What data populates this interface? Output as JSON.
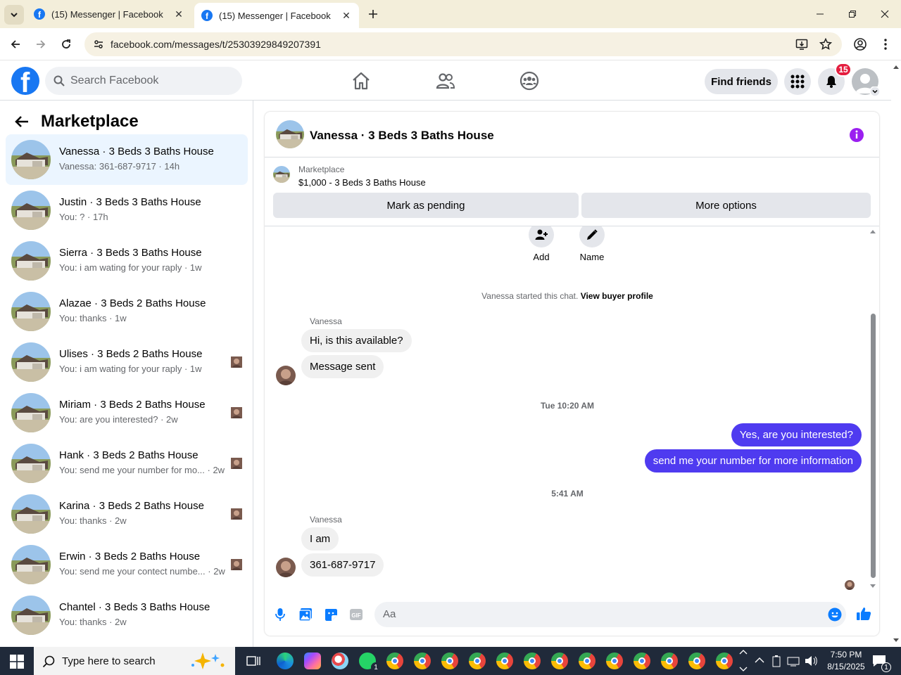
{
  "browser": {
    "tabs": [
      {
        "title": "(15) Messenger | Facebook"
      },
      {
        "title": "(15) Messenger | Facebook"
      }
    ],
    "url": "facebook.com/messages/t/25303929849207391"
  },
  "fb_header": {
    "search_placeholder": "Search Facebook",
    "find_friends": "Find friends",
    "notification_count": "15"
  },
  "left_panel": {
    "title": "Marketplace",
    "conversations": [
      {
        "name": "Vanessa · 3 Beds 3 Baths House",
        "preview": "Vanessa: 361-687-9717 · 14h"
      },
      {
        "name": "Justin · 3 Beds 3 Baths House",
        "preview": "You: ? · 17h"
      },
      {
        "name": "Sierra · 3 Beds 3 Baths House",
        "preview": "You: i am wating for your raply · 1w"
      },
      {
        "name": "Alazae · 3 Beds 2 Baths House",
        "preview": "You: thanks · 1w"
      },
      {
        "name": "Ulises · 3 Beds 2 Baths House",
        "preview": "You: i am wating for your raply · 1w"
      },
      {
        "name": "Miriam · 3 Beds 2 Baths House",
        "preview": "You: are you interested? · 2w"
      },
      {
        "name": "Hank · 3 Beds 2 Baths House",
        "preview": "You: send me your number for mo... · 2w"
      },
      {
        "name": "Karina · 3 Beds 2 Baths House",
        "preview": "You: thanks · 2w"
      },
      {
        "name": "Erwin · 3 Beds 2 Baths House",
        "preview": "You: send me your contect numbe... · 2w"
      },
      {
        "name": "Chantel · 3 Beds 3 Baths House",
        "preview": "You: thanks · 2w"
      }
    ]
  },
  "chat": {
    "title": "Vanessa · 3 Beds 3 Baths House",
    "listing_label": "Marketplace",
    "listing_title": "$1,000 - 3 Beds 3 Baths House",
    "mark_pending": "Mark as pending",
    "more_options": "More options",
    "actions": {
      "add": "Add",
      "name": "Name"
    },
    "started_text": "Vanessa started this chat.",
    "view_profile": "View buyer profile",
    "messages": {
      "sender1": "Vanessa",
      "in1": "Hi, is this available?",
      "in2": "Message sent",
      "stamp1": "Tue 10:20 AM",
      "out1": "Yes, are you interested?",
      "out2": "send me your number for more information",
      "stamp2": "5:41 AM",
      "sender2": "Vanessa",
      "in3": "I am",
      "in4": "361-687-9717"
    },
    "composer_placeholder": "Aa"
  },
  "taskbar": {
    "search_placeholder": "Type here to search",
    "time": "7:50 PM",
    "date": "8/15/2025",
    "whatsapp_badge": "1",
    "notif_badge": "1"
  },
  "colors": {
    "fb_blue": "#1877f2",
    "outgoing_bubble": "#4f3bf0",
    "incoming_bubble": "#f0f0f0",
    "active_conv": "#ebf5ff",
    "info_icon": "#9b1ff0"
  }
}
